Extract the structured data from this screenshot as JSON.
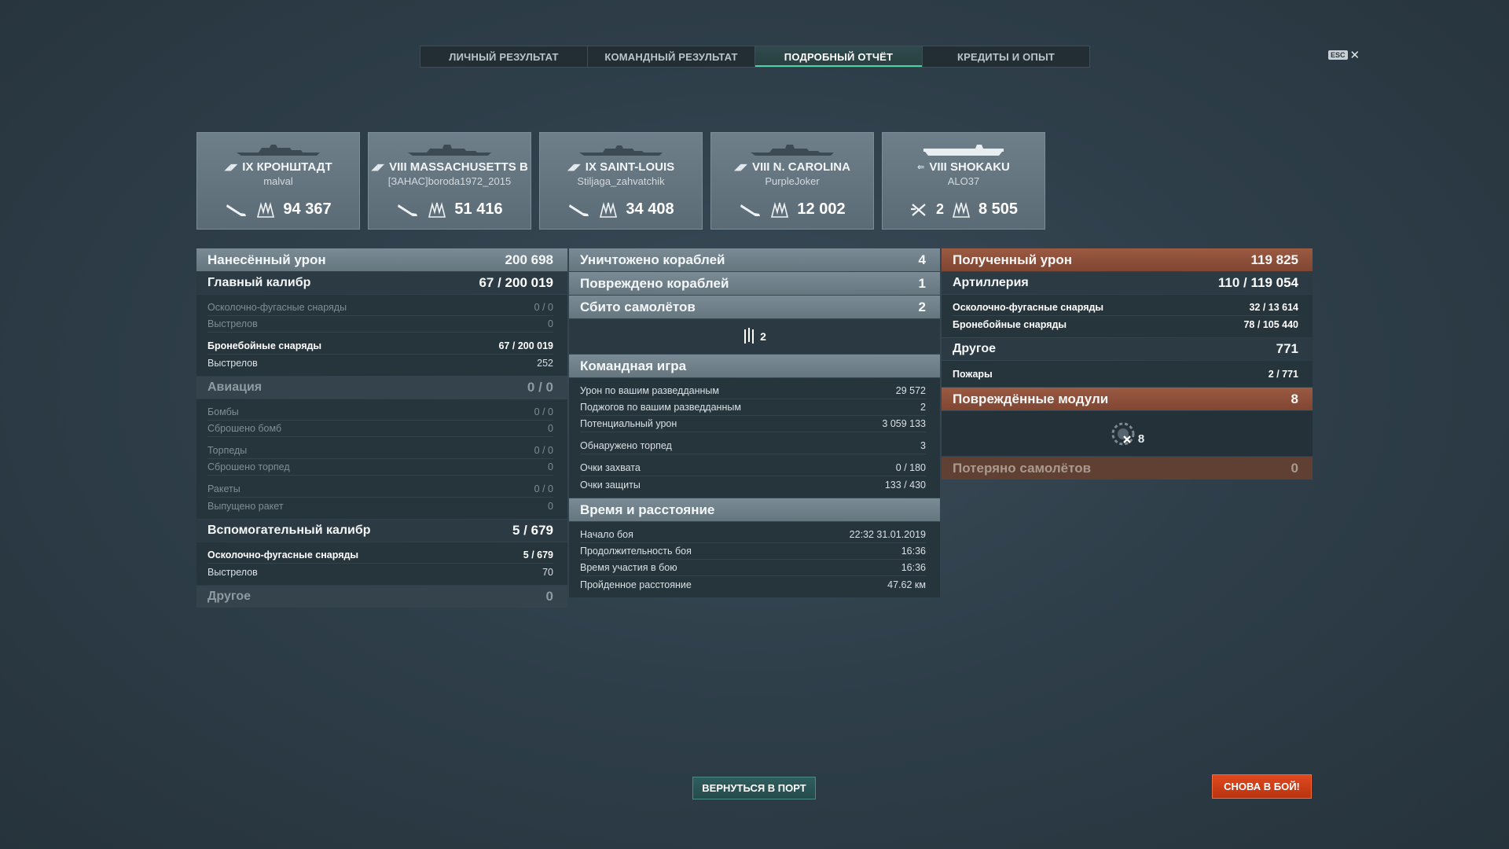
{
  "tabs": [
    {
      "label": "ЛИЧНЫЙ РЕЗУЛЬТАТ",
      "active": false
    },
    {
      "label": "КОМАНДНЫЙ РЕЗУЛЬТАТ",
      "active": false
    },
    {
      "label": "ПОДРОБНЫЙ ОТЧЁТ",
      "active": true
    },
    {
      "label": "КРЕДИТЫ И ОПЫТ",
      "active": false
    }
  ],
  "close": {
    "key": "ESC",
    "icon": "close-icon"
  },
  "ships": [
    {
      "tier_name": "IX КРОНШТАДТ",
      "class_icon": "cruiser-icon",
      "player": "malval",
      "damage": "94 367"
    },
    {
      "tier_name": "VIII MASSACHUSETTS B",
      "class_icon": "battleship-icon",
      "player": "[ЗАНАС]boroda1972_2015",
      "damage": "51 416"
    },
    {
      "tier_name": "IX SAINT-LOUIS",
      "class_icon": "cruiser-icon",
      "player": "Stiljaga_zahvatchik",
      "damage": "34 408"
    },
    {
      "tier_name": "VIII N. CAROLINA",
      "class_icon": "battleship-icon",
      "player": "PurpleJoker",
      "damage": "12 002"
    },
    {
      "tier_name": "VIII SHOKAKU",
      "class_icon": "carrier-icon",
      "player": "ALO37",
      "kills": "2",
      "damage": "8 505"
    }
  ],
  "left": {
    "header": {
      "label": "Нанесённый урон",
      "value": "200 698"
    },
    "main": {
      "label": "Главный калибр",
      "hits": "67",
      "dmg": "200 019"
    },
    "main_rows": [
      {
        "label": "Осколочно-фугасные снаряды",
        "value": "0 / 0"
      },
      {
        "label": "Выстрелов",
        "value": "0"
      },
      {
        "label": "Бронебойные снаряды",
        "hits": "67 / ",
        "dmg": "200 019"
      },
      {
        "label": "Выстрелов",
        "value": "252"
      }
    ],
    "aviation": {
      "label": "Авиация",
      "value": "0 / 0"
    },
    "aviation_rows": [
      {
        "label": "Бомбы",
        "value": "0 / 0"
      },
      {
        "label": "Сброшено бомб",
        "value": "0"
      },
      {
        "label": "Торпеды",
        "value": "0 / 0"
      },
      {
        "label": "Сброшено торпед",
        "value": "0"
      },
      {
        "label": "Ракеты",
        "value": "0 / 0"
      },
      {
        "label": "Выпущено ракет",
        "value": "0"
      }
    ],
    "secondary": {
      "label": "Вспомогательный калибр",
      "hits": "5",
      "dmg": "679"
    },
    "secondary_rows": [
      {
        "label": "Осколочно-фугасные снаряды",
        "hits": "5 / ",
        "dmg": "679"
      },
      {
        "label": "Выстрелов",
        "value": "70"
      }
    ],
    "other": {
      "label": "Другое",
      "value": "0"
    }
  },
  "middle": {
    "destroyed": {
      "label": "Уничтожено кораблей",
      "value": "4"
    },
    "damaged": {
      "label": "Повреждено кораблей",
      "value": "1"
    },
    "planes": {
      "label": "Сбито самолётов",
      "value": "2"
    },
    "planes_icon_count": "2",
    "team": {
      "label": "Командная игра"
    },
    "team_rows": [
      {
        "label": "Урон по вашим разведданным",
        "value": "29 572"
      },
      {
        "label": "Поджогов по вашим разведданным",
        "value": "2"
      },
      {
        "label": "Потенциальный урон",
        "value": "3 059 133"
      },
      {
        "label": "Обнаружено торпед",
        "value": "3"
      },
      {
        "label": "Очки захвата",
        "value": "0 / 180"
      },
      {
        "label": "Очки защиты",
        "value": "133 / 430"
      }
    ],
    "time": {
      "label": "Время и расстояние"
    },
    "time_rows": [
      {
        "label": "Начало боя",
        "value": "22:32  31.01.2019"
      },
      {
        "label": "Продолжительность боя",
        "value": "16:36"
      },
      {
        "label": "Время участия в бою",
        "value": "16:36"
      },
      {
        "label": "Пройденное расстояние",
        "value": "47.62 км"
      }
    ]
  },
  "right": {
    "header": {
      "label": "Полученный урон",
      "value": "119 825"
    },
    "artillery": {
      "label": "Артиллерия",
      "hits": "110",
      "dmg": "119 054"
    },
    "artillery_rows": [
      {
        "label": "Осколочно-фугасные снаряды",
        "hits": "32 / ",
        "dmg": "13 614"
      },
      {
        "label": "Бронебойные снаряды",
        "hits": "78 / ",
        "dmg": "105 440"
      }
    ],
    "other": {
      "label": "Другое",
      "value": "771"
    },
    "other_rows": [
      {
        "label": "Пожары",
        "hits": "2 / ",
        "dmg": "771"
      }
    ],
    "modules": {
      "label": "Повреждённые модули",
      "value": "8"
    },
    "modules_icon_count": "8",
    "lost_planes": {
      "label": "Потеряно самолётов",
      "value": "0"
    }
  },
  "buttons": {
    "port": "ВЕРНУТЬСЯ В ПОРТ",
    "battle": "СНОВА В БОЙ!"
  },
  "colors": {
    "accent": "#4fd1a5",
    "battle_button": "#d8431b",
    "received_header": "#9c5a42"
  }
}
